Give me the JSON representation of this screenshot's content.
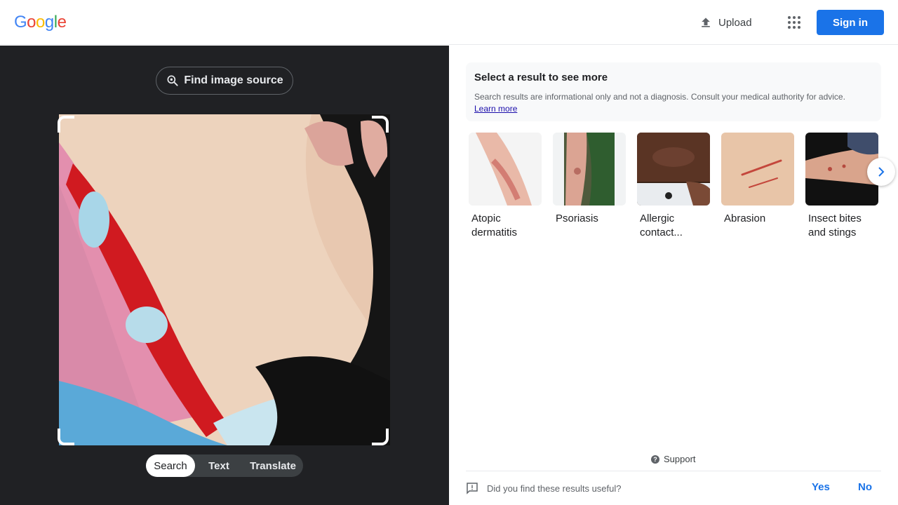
{
  "header": {
    "logo": [
      "G",
      "o",
      "o",
      "g",
      "l",
      "e"
    ],
    "logo_colors": [
      "#4285f4",
      "#ea4335",
      "#fbbc05",
      "#4285f4",
      "#34a853",
      "#ea4335"
    ],
    "upload_label": "Upload",
    "signin_label": "Sign in"
  },
  "lens": {
    "find_source_label": "Find image source",
    "modes": [
      "Search",
      "Text",
      "Translate"
    ],
    "active_mode": "Search"
  },
  "results_panel": {
    "info_title": "Select a result to see more",
    "info_text": "Search results are informational only and not a diagnosis. Consult your medical authority for advice.",
    "learn_more": "Learn more",
    "items": [
      {
        "label": "Atopic dermatitis",
        "icon": "atopic-dermatitis-thumbnail"
      },
      {
        "label": "Psoriasis",
        "icon": "psoriasis-thumbnail"
      },
      {
        "label": "Allergic contact...",
        "icon": "allergic-contact-thumbnail"
      },
      {
        "label": "Abrasion",
        "icon": "abrasion-thumbnail"
      },
      {
        "label": "Insect bites and stings",
        "icon": "insect-bites-thumbnail"
      }
    ],
    "support_label": "Support",
    "feedback_question": "Did you find these results useful?",
    "feedback_yes": "Yes",
    "feedback_no": "No"
  },
  "colors": {
    "accent": "#1a73e8",
    "left_bg": "#202124"
  }
}
